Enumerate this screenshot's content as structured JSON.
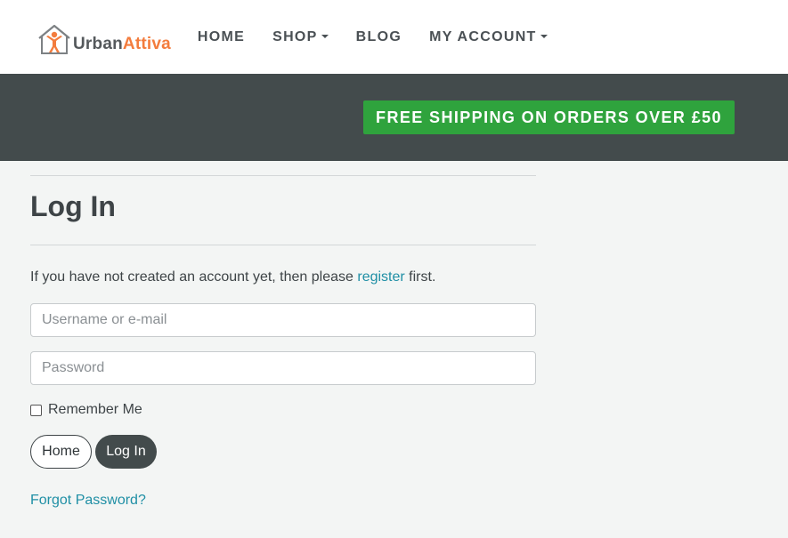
{
  "brand": {
    "name_part1": "Urban",
    "name_part2": "Attiva",
    "logo_icon": "house-person-icon",
    "colors": {
      "dark": "#55595c",
      "accent": "#f37c3d"
    }
  },
  "nav": {
    "items": [
      {
        "label": "HOME",
        "dropdown": false
      },
      {
        "label": "SHOP",
        "dropdown": true
      },
      {
        "label": "BLOG",
        "dropdown": false
      },
      {
        "label": "MY ACCOUNT",
        "dropdown": true
      }
    ]
  },
  "banner": {
    "shipping_text": "FREE SHIPPING ON ORDERS OVER £50",
    "background": "#434b4c",
    "badge_color": "#2fa33d"
  },
  "login": {
    "title": "Log In",
    "intro_before": "If you have not created an account yet, then please ",
    "intro_link": "register",
    "intro_after": " first.",
    "username_placeholder": "Username or e-mail",
    "password_placeholder": "Password",
    "remember_label": "Remember Me",
    "remember_checked": false,
    "home_button": "Home",
    "login_button": "Log In",
    "forgot_link": "Forgot Password?",
    "link_color": "#1f8fa5"
  }
}
